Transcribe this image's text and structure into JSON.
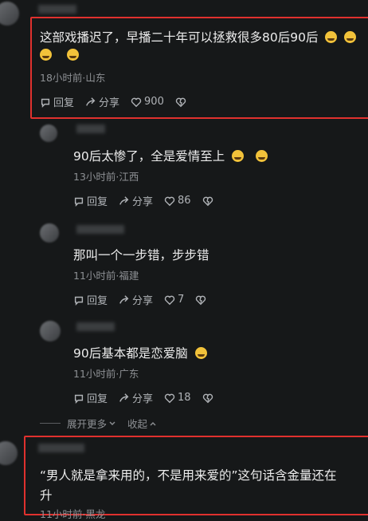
{
  "comments": [
    {
      "text_line1": "这部戏播迟了，早播二十年可以拯救很多80后90后",
      "emoji_line1": [
        "grinning-sweat-emoji",
        "grinning-sweat-emoji"
      ],
      "emoji_line2": [
        "crying-emoji",
        "crying-emoji"
      ],
      "meta": "18小时前·山东",
      "reply": "回复",
      "share": "分享",
      "likes": "900"
    },
    {
      "text": "90后太惨了，全是爱情至上",
      "emoji": [
        "crying-emoji",
        "crying-emoji"
      ],
      "meta": "13小时前·江西",
      "reply": "回复",
      "share": "分享",
      "likes": "86"
    },
    {
      "text": "那叫一个一步错，步步错",
      "meta": "11小时前·福建",
      "reply": "回复",
      "share": "分享",
      "likes": "7"
    },
    {
      "text": "90后基本都是恋爱脑",
      "emoji": [
        "laughing-crying-emoji"
      ],
      "meta": "11小时前·广东",
      "reply": "回复",
      "share": "分享",
      "likes": "18"
    },
    {
      "text_line1": "“男人就是拿来用的，不是用来爱的”这句话含金量还在",
      "text_line2": "升",
      "meta": "11小时前·黑龙"
    }
  ],
  "expand_more": "展开更多",
  "collapse": "收起"
}
